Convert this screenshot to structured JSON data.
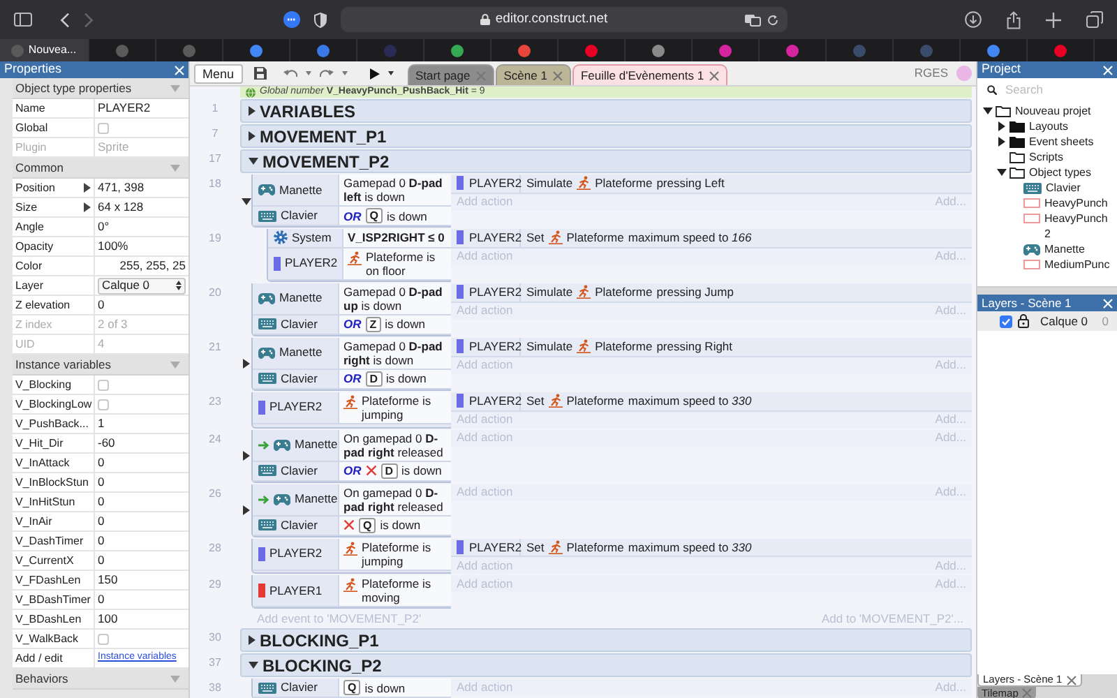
{
  "browser": {
    "url": "editor.construct.net",
    "tabs": [
      {
        "label": "Nouvea...",
        "selected": true,
        "color": "#5a5a5a"
      },
      {
        "selected": false,
        "color": "#5a5a5a"
      },
      {
        "selected": false,
        "color": "#5a5a5a"
      },
      {
        "selected": false,
        "color": "#4285f4"
      },
      {
        "selected": false,
        "color": "#3b78e7"
      },
      {
        "selected": false,
        "color": "#2a2a55"
      },
      {
        "selected": false,
        "color": "#34a853"
      },
      {
        "selected": false,
        "color": "#e8453c"
      },
      {
        "selected": false,
        "color": "#e60023"
      },
      {
        "selected": false,
        "color": "#8a8a8a"
      },
      {
        "selected": false,
        "color": "#d6249f"
      },
      {
        "selected": false,
        "color": "#d6249f"
      },
      {
        "selected": false,
        "color": "#3a4a6a"
      },
      {
        "selected": false,
        "color": "#3a4a6a"
      },
      {
        "selected": false,
        "color": "#4285f4"
      },
      {
        "selected": false,
        "color": "#e60023"
      }
    ]
  },
  "properties": {
    "title": "Properties",
    "sections": [
      {
        "title": "Object type properties",
        "expanded": true,
        "rows": [
          {
            "label": "Name",
            "kind": "text",
            "value": "PLAYER2",
            "disabled": false
          },
          {
            "label": "Global",
            "kind": "checkbox",
            "checked": false,
            "disabled": false
          },
          {
            "label": "Plugin",
            "kind": "text",
            "value": "Sprite",
            "disabled": true
          }
        ]
      },
      {
        "title": "Common",
        "expanded": true,
        "rows": [
          {
            "label": "Position",
            "kind": "expander",
            "value": "471, 398",
            "disabled": false
          },
          {
            "label": "Size",
            "kind": "expander",
            "value": "64 x 128",
            "disabled": false
          },
          {
            "label": "Angle",
            "kind": "text",
            "value": "0°",
            "disabled": false
          },
          {
            "label": "Opacity",
            "kind": "text",
            "value": "100%",
            "disabled": false
          },
          {
            "label": "Color",
            "kind": "color",
            "value": "255, 255, 25",
            "disabled": false
          },
          {
            "label": "Layer",
            "kind": "dropdown",
            "value": "Calque 0",
            "disabled": false
          },
          {
            "label": "Z elevation",
            "kind": "text",
            "value": "0",
            "disabled": false
          },
          {
            "label": "Z index",
            "kind": "text",
            "value": "2 of 3",
            "disabled": true
          },
          {
            "label": "UID",
            "kind": "text",
            "value": "4",
            "disabled": true
          }
        ]
      },
      {
        "title": "Instance variables",
        "expanded": true,
        "rows": [
          {
            "label": "V_Blocking",
            "kind": "checkbox",
            "checked": false,
            "disabled": false
          },
          {
            "label": "V_BlockingLow",
            "kind": "checkbox",
            "checked": false,
            "disabled": false
          },
          {
            "label": "V_PushBack...",
            "kind": "text",
            "value": "1",
            "disabled": false
          },
          {
            "label": "V_Hit_Dir",
            "kind": "text",
            "value": "-60",
            "disabled": false
          },
          {
            "label": "V_InAttack",
            "kind": "text",
            "value": "0",
            "disabled": false
          },
          {
            "label": "V_InBlockStun",
            "kind": "text",
            "value": "0",
            "disabled": false
          },
          {
            "label": "V_InHitStun",
            "kind": "text",
            "value": "0",
            "disabled": false
          },
          {
            "label": "V_InAir",
            "kind": "text",
            "value": "0",
            "disabled": false
          },
          {
            "label": "V_DashTimer",
            "kind": "text",
            "value": "0",
            "disabled": false
          },
          {
            "label": "V_CurrentX",
            "kind": "text",
            "value": "0",
            "disabled": false
          },
          {
            "label": "V_FDashLen",
            "kind": "text",
            "value": "150",
            "disabled": false
          },
          {
            "label": "V_BDashTimer",
            "kind": "text",
            "value": "0",
            "disabled": false
          },
          {
            "label": "V_BDashLen",
            "kind": "text",
            "value": "100",
            "disabled": false
          },
          {
            "label": "V_WalkBack",
            "kind": "checkbox",
            "checked": false,
            "disabled": false
          },
          {
            "label": "Add / edit",
            "kind": "link",
            "value": "Instance variables",
            "disabled": false
          }
        ]
      },
      {
        "title": "Behaviors",
        "expanded": true
      }
    ]
  },
  "event_sheet": {
    "menu": "Menu",
    "tabs": [
      {
        "label": "Start page",
        "selected": false,
        "color": "#8c8c8c"
      },
      {
        "label": "Scène 1",
        "selected": false,
        "color": "#bdb597"
      },
      {
        "label": "Feuille d'Evènements 1",
        "selected": true,
        "color": "#fbe1e3"
      }
    ],
    "user": "RGES",
    "global_variable": "*Global number* **V_HeavyPunch_PushBack_Hit** = 9",
    "rows": [
      {
        "line": "1",
        "title": "VARIABLES",
        "expanded": false
      },
      {
        "line": "7",
        "title": "MOVEMENT_P1",
        "expanded": false
      },
      {
        "line": "17",
        "title": "MOVEMENT_P2",
        "expanded": true,
        "children": [
          {
            "kind": "event",
            "line": "18",
            "expanded": true,
            "conditions": [
              {
                "object": "Manette",
                "kind": "gamepad",
                "trigger": false,
                "negated": false,
                "text": "Gamepad 0 **D-pad left** is down"
              },
              {
                "object": "Clavier",
                "kind": "keyboard",
                "trigger": false,
                "negated": false,
                "prefix": "OR",
                "key": "Q",
                "text": "is down"
              }
            ],
            "actions": [
              {
                "object": "PLAYER2",
                "color": "#6b6be6",
                "verb": "Simulate",
                "behavior": "Plateforme",
                "text": "pressing Left"
              }
            ],
            "add_action": "Add action",
            "add_more": "Add...",
            "children": [
              {
                "kind": "event",
                "line": "19",
                "conditions": [
                  {
                    "object": "System",
                    "kind": "system",
                    "trigger": false,
                    "negated": false,
                    "text": "**V_ISP2RIGHT ≤ 0**"
                  },
                  {
                    "object": "PLAYER2",
                    "kind": "sprite",
                    "color": "#6b6be6",
                    "trigger": false,
                    "negated": false,
                    "behavior": "Plateforme",
                    "text": "is on floor"
                  }
                ],
                "actions": [
                  {
                    "object": "PLAYER2",
                    "color": "#6b6be6",
                    "verb": "Set",
                    "behavior": "Plateforme",
                    "text": "maximum speed to *166*"
                  }
                ],
                "add_action": "Add action",
                "add_more": "Add..."
              }
            ]
          },
          {
            "kind": "event",
            "line": "20",
            "conditions": [
              {
                "object": "Manette",
                "kind": "gamepad",
                "trigger": false,
                "negated": false,
                "text": "Gamepad 0 **D-pad up** is down"
              },
              {
                "object": "Clavier",
                "kind": "keyboard",
                "trigger": false,
                "negated": false,
                "prefix": "OR",
                "key": "Z",
                "text": "is down"
              }
            ],
            "actions": [
              {
                "object": "PLAYER2",
                "color": "#6b6be6",
                "verb": "Simulate",
                "behavior": "Plateforme",
                "text": "pressing Jump"
              }
            ],
            "add_action": "Add action",
            "add_more": "Add..."
          },
          {
            "kind": "event",
            "line": "21",
            "expanded": false,
            "conditions": [
              {
                "object": "Manette",
                "kind": "gamepad",
                "trigger": false,
                "negated": false,
                "text": "Gamepad 0 **D-pad right** is down"
              },
              {
                "object": "Clavier",
                "kind": "keyboard",
                "trigger": false,
                "negated": false,
                "prefix": "OR",
                "key": "D",
                "text": "is down"
              }
            ],
            "actions": [
              {
                "object": "PLAYER2",
                "color": "#6b6be6",
                "verb": "Simulate",
                "behavior": "Plateforme",
                "text": "pressing Right"
              }
            ],
            "add_action": "Add action",
            "add_more": "Add..."
          },
          {
            "kind": "event",
            "line": "23",
            "conditions": [
              {
                "object": "PLAYER2",
                "kind": "sprite",
                "color": "#6b6be6",
                "trigger": false,
                "negated": false,
                "behavior": "Plateforme",
                "text": "is jumping"
              }
            ],
            "actions": [
              {
                "object": "PLAYER2",
                "color": "#6b6be6",
                "verb": "Set",
                "behavior": "Plateforme",
                "text": "maximum speed to *330*"
              }
            ],
            "add_action": "Add action",
            "add_more": "Add..."
          },
          {
            "kind": "event",
            "line": "24",
            "expanded": false,
            "conditions": [
              {
                "object": "Manette",
                "kind": "gamepad",
                "trigger": true,
                "negated": false,
                "text": "On gamepad 0 **D-pad right** released"
              },
              {
                "object": "Clavier",
                "kind": "keyboard",
                "trigger": false,
                "negated": true,
                "prefix": "OR",
                "key": "D",
                "text": "is down"
              }
            ],
            "add_action": "Add action",
            "add_more": "Add..."
          },
          {
            "kind": "event",
            "line": "26",
            "expanded": false,
            "conditions": [
              {
                "object": "Manette",
                "kind": "gamepad",
                "trigger": true,
                "negated": false,
                "text": "On gamepad 0 **D-pad right** released"
              },
              {
                "object": "Clavier",
                "kind": "keyboard",
                "trigger": false,
                "negated": true,
                "key": "Q",
                "text": "is down"
              }
            ],
            "add_action": "Add action",
            "add_more": "Add..."
          },
          {
            "kind": "event",
            "line": "28",
            "conditions": [
              {
                "object": "PLAYER2",
                "kind": "sprite",
                "color": "#6b6be6",
                "trigger": false,
                "negated": false,
                "behavior": "Plateforme",
                "text": "is jumping"
              }
            ],
            "actions": [
              {
                "object": "PLAYER2",
                "color": "#6b6be6",
                "verb": "Set",
                "behavior": "Plateforme",
                "text": "maximum speed to *330*"
              }
            ],
            "add_action": "Add action",
            "add_more": "Add..."
          },
          {
            "kind": "event",
            "line": "29",
            "conditions": [
              {
                "object": "PLAYER1",
                "kind": "sprite",
                "color": "#e53935",
                "trigger": false,
                "negated": false,
                "behavior": "Plateforme",
                "text": "is moving"
              }
            ],
            "add_action": "Add action",
            "add_more": "Add..."
          },
          {
            "kind": "add_event",
            "label": "Add event to 'MOVEMENT_P2'",
            "extra": "Add to 'MOVEMENT_P2'..."
          }
        ]
      },
      {
        "line": "30",
        "title": "BLOCKING_P1",
        "expanded": false
      },
      {
        "line": "37",
        "title": "BLOCKING_P2",
        "expanded": true,
        "children": [
          {
            "kind": "event",
            "line": "38",
            "conditions": [
              {
                "object": "Clavier",
                "kind": "keyboard",
                "trigger": false,
                "negated": false,
                "key": "Q",
                "text": "is down"
              }
            ],
            "add_action": "Add action",
            "add_more": "Add..."
          }
        ]
      }
    ]
  },
  "project": {
    "title": "Project",
    "search_placeholder": "Search",
    "tree": [
      {
        "label": "Nouveau projet",
        "kind": "folder",
        "expanded": true,
        "children": [
          {
            "label": "Layouts",
            "kind": "folder_filled",
            "expanded": false
          },
          {
            "label": "Event sheets",
            "kind": "folder_filled",
            "expanded": false
          },
          {
            "label": "Scripts",
            "kind": "folder"
          },
          {
            "label": "Object types",
            "kind": "folder",
            "expanded": true,
            "children": [
              {
                "label": "Clavier",
                "kind": "keyboard"
              },
              {
                "label": "HeavyPunch",
                "kind": "sprite_outline"
              },
              {
                "label": "HeavyPunch 2",
                "kind": "sprite_outline"
              },
              {
                "label": "Manette",
                "kind": "gamepad"
              },
              {
                "label": "MediumPunc",
                "kind": "sprite_outline"
              }
            ]
          }
        ]
      }
    ]
  },
  "layers": {
    "title": "Layers - Scène 1",
    "items": [
      {
        "name": "Calque 0",
        "visible": true,
        "locked": true,
        "index": "0"
      }
    ]
  },
  "bottom_tabs": [
    {
      "label": "Layers - Scène 1",
      "selected": true
    },
    {
      "label": "Tilemap",
      "selected": false
    }
  ]
}
